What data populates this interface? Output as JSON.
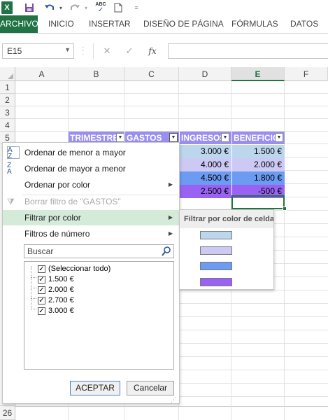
{
  "app": {
    "logo": "X"
  },
  "qat": {
    "icons": [
      "excel-logo",
      "save-icon",
      "undo-icon",
      "redo-icon",
      "spelling-icon",
      "new-icon"
    ],
    "spelling_label": "ABC"
  },
  "ribbon": {
    "tabs": [
      "ARCHIVO",
      "INICIO",
      "INSERTAR",
      "DISEÑO DE PÁGINA",
      "FÓRMULAS",
      "DATOS"
    ],
    "active_tab": "ARCHIVO",
    "active_color": "#217346"
  },
  "formula_bar": {
    "name_box": "E15",
    "cancel_symbol": "✕",
    "enter_symbol": "✓",
    "fx_symbol": "fx",
    "value": ""
  },
  "grid": {
    "columns": [
      "A",
      "B",
      "C",
      "D",
      "E",
      "F"
    ],
    "selected_column": "E",
    "rows": [
      "1",
      "2",
      "3",
      "4",
      "5",
      "26"
    ]
  },
  "table": {
    "headers": [
      "TRIMESTRE",
      "GASTOS",
      "INGRESOS",
      "BENEFICIO"
    ],
    "header_color": "#9a8ef0",
    "ingresos": [
      "3.000 €",
      "4.000 €",
      "4.500 €",
      "2.500 €"
    ],
    "beneficio": [
      "1.500 €",
      "2.000 €",
      "1.800 €",
      "-500 €"
    ],
    "row_colors": [
      "#bcd6ee",
      "#ccc9f5",
      "#6c9bf2",
      "#9a62f3"
    ]
  },
  "filter_menu": {
    "items": [
      "Ordenar de menor a mayor",
      "Ordenar de mayor a menor",
      "Ordenar por color",
      "Borrar filtro de \"GASTOS\"",
      "Filtrar por color",
      "Filtros de número"
    ],
    "search_placeholder": "Buscar",
    "list": [
      "(Seleccionar todo)",
      "1.500 €",
      "2.000 €",
      "2.700 €",
      "3.000 €"
    ],
    "ok_label": "ACEPTAR",
    "cancel_label": "Cancelar",
    "highlight_color": "#d5ebd9"
  },
  "color_submenu": {
    "title": "Filtrar por color de celda",
    "swatches": [
      "#bcd6ee",
      "#ccc9f5",
      "#6c9bf2",
      "#9a62f3"
    ]
  }
}
